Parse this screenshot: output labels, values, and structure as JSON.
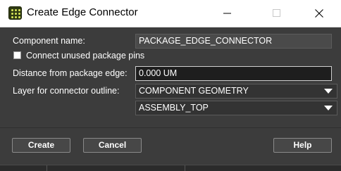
{
  "window": {
    "title": "Create Edge Connector",
    "icon": "grid-app-icon"
  },
  "form": {
    "component_name_label": "Component name:",
    "component_name_value": "PACKAGE_EDGE_CONNECTOR",
    "connect_unused_label": "Connect unused package pins",
    "connect_unused_checked": false,
    "distance_label": "Distance from package edge:",
    "distance_value": "0.000 UM",
    "layer_label": "Layer for connector outline:",
    "layer_class_selected": "COMPONENT GEOMETRY",
    "layer_subclass_selected": "ASSEMBLY_TOP"
  },
  "buttons": {
    "create": "Create",
    "cancel": "Cancel",
    "help": "Help"
  },
  "colors": {
    "dialog_bg": "#3c3c3c",
    "titlebar_bg": "#ffffff",
    "text": "#ffffff"
  }
}
